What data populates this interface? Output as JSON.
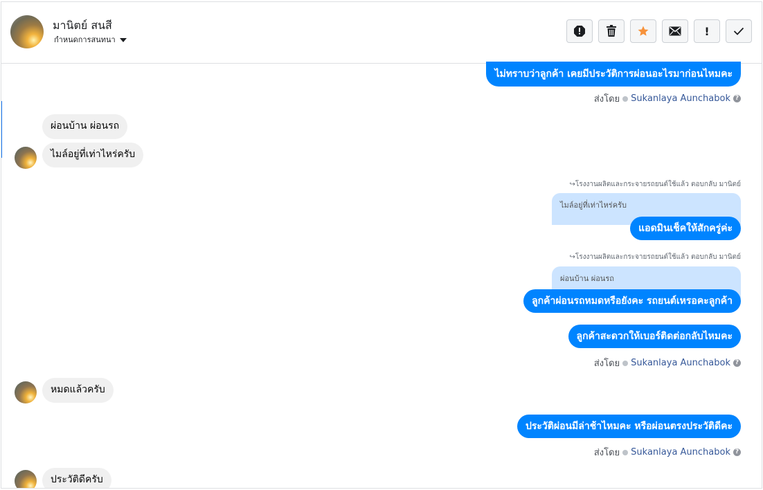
{
  "header": {
    "name": "มานิตย์ สนสี",
    "assign_label": "กำหนดการสนทนา"
  },
  "actions": [
    {
      "icon": "report-icon"
    },
    {
      "icon": "trash-icon"
    },
    {
      "icon": "star-icon"
    },
    {
      "icon": "mail-icon"
    },
    {
      "icon": "exclamation-icon",
      "label": "!"
    },
    {
      "icon": "check-icon"
    }
  ],
  "colors": {
    "outgoing": "#0084ff",
    "incoming": "#f0f0f0",
    "quote": "#cce4ff",
    "star": "#f7923b"
  },
  "sent_by": {
    "prefix": "ส่งโดย",
    "agent": "Sukanlaya Aunchabok",
    "help": "?"
  },
  "messages": {
    "m1": "ไม่ทราบว่าลูกค้า เคยมีประวัติการผ่อนอะไรมาก่อนไหมคะ",
    "m2": "ผ่อนบ้าน ผ่อนรถ",
    "m3": "ไมล์อยู่ที่เท่าไหร่ครับ",
    "reply1_note": "โรงงานผลิตและกระจายรถยนต์ใช้แล้ว ตอบกลับ มานิตย์",
    "reply1_quote": "ไมล์อยู่ที่เท่าไหร่ครับ",
    "m4": "แอดมินเช็คให้สักครู่ค่ะ",
    "reply2_note": "โรงงานผลิตและกระจายรถยนต์ใช้แล้ว ตอบกลับ มานิตย์",
    "reply2_quote": "ผ่อนบ้าน ผ่อนรถ",
    "m5": "ลูกค้าผ่อนรถหมดหรือยังคะ รถยนต์เหรอคะลูกค้า",
    "m6": "ลูกค้าสะดวกให้เบอร์ติดต่อกลับไหมคะ",
    "m7": "หมดแล้วครับ",
    "m8": "ประวัติผ่อนมีล่าช้าไหมคะ หรือผ่อนตรงประวัติดีคะ",
    "m9": "ประวัติดีครับ"
  }
}
